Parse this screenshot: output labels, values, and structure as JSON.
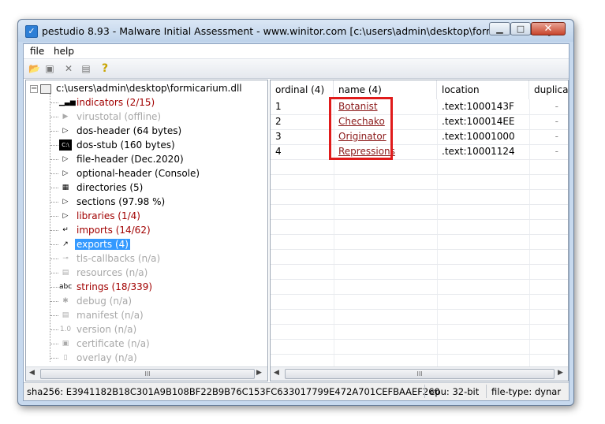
{
  "window": {
    "title": "pestudio 8.93 - Malware Initial Assessment - www.winitor.com [c:\\users\\admin\\desktop\\formicarium.dll]",
    "app_icon": "checkmark-icon",
    "controls": {
      "minimize": "minimize-icon",
      "maximize": "maximize-icon",
      "close": "close-icon"
    }
  },
  "menu": {
    "file": "file",
    "help": "help"
  },
  "toolbar": {
    "icons": [
      "open-icon",
      "save-icon",
      "delete-icon",
      "copy-icon",
      "help-icon"
    ]
  },
  "tree": {
    "root": "c:\\users\\admin\\desktop\\formicarium.dll",
    "items": [
      {
        "label": "indicators (2/15)",
        "style": "red",
        "icon": "indicators-bars-icon"
      },
      {
        "label": "virustotal (offline)",
        "style": "gray",
        "icon": "virustotal-icon"
      },
      {
        "label": "dos-header (64 bytes)",
        "style": "black",
        "icon": "arrow-right-icon"
      },
      {
        "label": "dos-stub (160 bytes)",
        "style": "black",
        "icon": "console-icon"
      },
      {
        "label": "file-header (Dec.2020)",
        "style": "black",
        "icon": "arrow-right-icon"
      },
      {
        "label": "optional-header (Console)",
        "style": "black",
        "icon": "arrow-right-icon"
      },
      {
        "label": "directories (5)",
        "style": "black",
        "icon": "directories-icon"
      },
      {
        "label": "sections (97.98 %)",
        "style": "black",
        "icon": "arrow-right-icon"
      },
      {
        "label": "libraries (1/4)",
        "style": "red",
        "icon": "arrow-right-icon"
      },
      {
        "label": "imports (14/62)",
        "style": "red",
        "icon": "imports-icon"
      },
      {
        "label": "exports (4)",
        "style": "selected",
        "icon": "exports-icon"
      },
      {
        "label": "tls-callbacks (n/a)",
        "style": "gray",
        "icon": "key-icon"
      },
      {
        "label": "resources (n/a)",
        "style": "gray",
        "icon": "resources-icon"
      },
      {
        "label": "strings (18/339)",
        "style": "red",
        "icon": "abc-icon"
      },
      {
        "label": "debug (n/a)",
        "style": "gray",
        "icon": "bug-icon"
      },
      {
        "label": "manifest (n/a)",
        "style": "gray",
        "icon": "manifest-icon"
      },
      {
        "label": "version (n/a)",
        "style": "gray",
        "icon": "version-icon"
      },
      {
        "label": "certificate (n/a)",
        "style": "gray",
        "icon": "certificate-icon"
      },
      {
        "label": "overlay (n/a)",
        "style": "gray",
        "icon": "overlay-icon"
      }
    ]
  },
  "table": {
    "columns": [
      "ordinal (4)",
      "name (4)",
      "location",
      "duplicate"
    ],
    "rows": [
      {
        "ordinal": "1",
        "name": "Botanist",
        "location": ".text:1000143F",
        "duplicate": "-"
      },
      {
        "ordinal": "2",
        "name": "Chechako",
        "location": ".text:100014EE",
        "duplicate": "-"
      },
      {
        "ordinal": "3",
        "name": "Originator",
        "location": ".text:10001000",
        "duplicate": "-"
      },
      {
        "ordinal": "4",
        "name": "Repressions",
        "location": ".text:10001124",
        "duplicate": "-"
      }
    ]
  },
  "scrollbar_thumb": "III",
  "status": {
    "sha256": "sha256: E3941182B18C301A9B108BF22B9B76C153FC633017799E472A701CEFBAAEF260",
    "cpu": "cpu: 32-bit",
    "filetype": "file-type: dynar"
  },
  "colors": {
    "accent": "#3399ff",
    "red_text": "#a10000",
    "highlight_box": "#e01b1b"
  }
}
